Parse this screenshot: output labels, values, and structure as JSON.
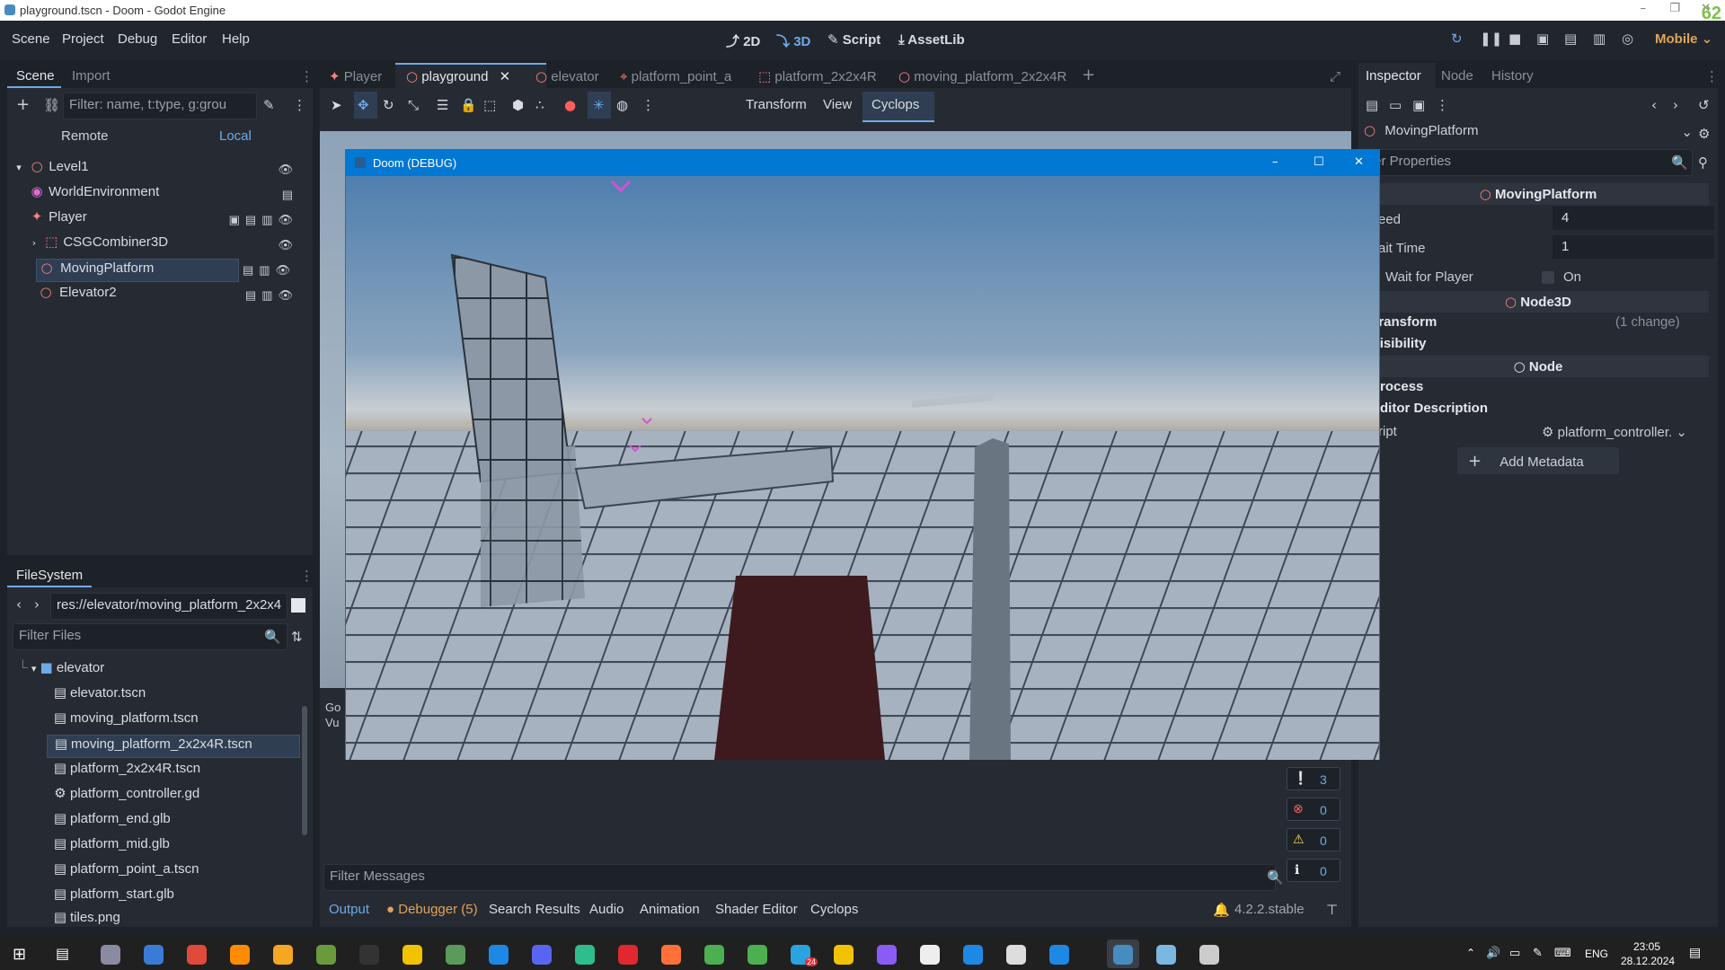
{
  "window": {
    "title": "playground.tscn - Doom - Godot Engine",
    "fps": "62"
  },
  "menu": {
    "items": [
      "Scene",
      "Project",
      "Debug",
      "Editor",
      "Help"
    ]
  },
  "modes": {
    "m2d": "2D",
    "m3d": "3D",
    "script": "Script",
    "assetlib": "AssetLib"
  },
  "renderer": "Mobile",
  "scene_panel": {
    "tabs": [
      "Scene",
      "Import"
    ],
    "filter_placeholder": "Filter: name, t:type, g:grou",
    "remote": "Remote",
    "local": "Local",
    "nodes": [
      "Level1",
      "WorldEnvironment",
      "Player",
      "CSGCombiner3D",
      "MovingPlatform",
      "Elevator2"
    ]
  },
  "filesystem": {
    "tab": "FileSystem",
    "path": "res://elevator/moving_platform_2x2x4",
    "filter_placeholder": "Filter Files",
    "folder": "elevator",
    "files": [
      "elevator.tscn",
      "moving_platform.tscn",
      "moving_platform_2x2x4R.tscn",
      "platform_2x2x4R.tscn",
      "platform_controller.gd",
      "platform_end.glb",
      "platform_mid.glb",
      "platform_point_a.tscn",
      "platform_start.glb",
      "tiles.png"
    ]
  },
  "editor_tabs": [
    "Player",
    "playground",
    "elevator",
    "platform_point_a",
    "platform_2x2x4R",
    "moving_platform_2x2x4R"
  ],
  "toolbar": {
    "transform": "Transform",
    "view": "View",
    "cyclops": "Cyclops"
  },
  "game_window": {
    "title": "Doom (DEBUG)"
  },
  "bottom": {
    "filter_placeholder": "Filter Messages",
    "tabs": [
      "Output",
      "Debugger (5)",
      "Search Results",
      "Audio",
      "Animation",
      "Shader Editor",
      "Cyclops"
    ],
    "version": "4.2.2.stable",
    "counts": [
      "3",
      "0",
      "0",
      "0"
    ],
    "partial": [
      "Go",
      "Vu"
    ]
  },
  "inspector": {
    "tabs": [
      "Inspector",
      "Node",
      "History"
    ],
    "node": "MovingPlatform",
    "filter_placeholder": "ter Properties",
    "sections": {
      "moving": "MovingPlatform",
      "node3d": "Node3D",
      "node": "Node"
    },
    "props": {
      "speed_label": "eed",
      "speed": "4",
      "wait_label": "ait Time",
      "wait": "1",
      "wfp_label": "Wait for Player",
      "wfp": "On",
      "transform": "Transform",
      "transform_note": "(1 change)",
      "visibility": "Visibility",
      "process": "Process",
      "editor_desc": "Editor Description",
      "script_label": "ript",
      "script": "platform_controller."
    },
    "add_metadata": "Add Metadata"
  },
  "taskbar": {
    "time": "23:05",
    "date": "28.12.2024",
    "lang": "ENG",
    "badge": "24"
  },
  "colors": {
    "accent": "#6eaae8",
    "panel": "#262b33",
    "bg": "#1d2229",
    "win_blue": "#0078d4",
    "fps_green": "#7dc24a"
  }
}
